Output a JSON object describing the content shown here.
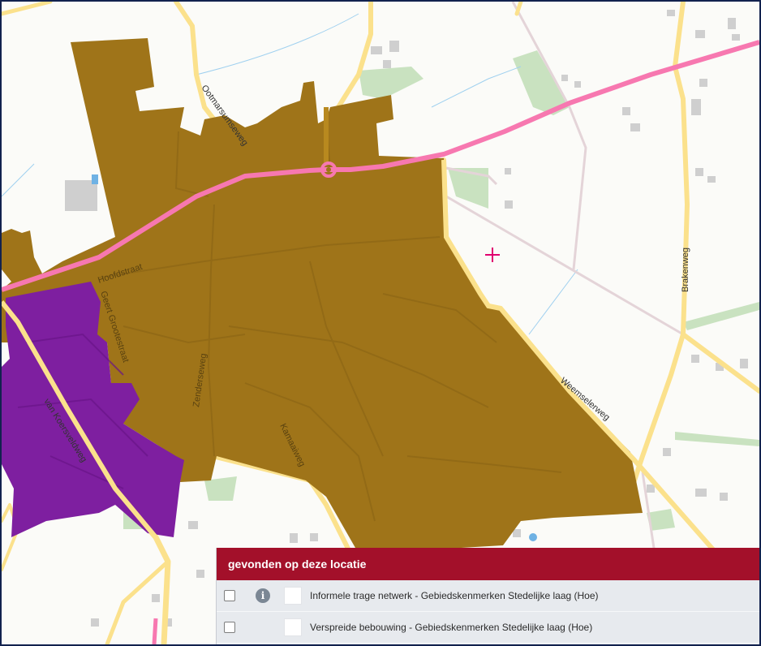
{
  "map": {
    "road_labels": {
      "ootmarsumseweg": "Ootmarsumseweg",
      "hoofdstraat": "Hoofdstraat",
      "geert_grootestraat": "Geert Grootestraat",
      "zenderseweg": "Zenderseweg",
      "kamaaiweg": "Kamaaiweg",
      "van_koersveldweg": "van Koersveldweg",
      "weemselerweg": "Weemselerweg",
      "brakenweg": "Brakenweg"
    },
    "colors": {
      "built_area": "#9f7419",
      "dispersed_area": "#7e1fa0",
      "main_road": "#f778b0",
      "road": "#fbe18c",
      "greenery": "#c9e2c0",
      "water": "#9fd0ef",
      "marker": "#e0006f"
    }
  },
  "results_panel": {
    "title": "gevonden op deze locatie",
    "items": [
      {
        "label": "Informele trage netwerk - Gebiedskenmerken Stedelijke laag (Hoe)",
        "has_info": true
      },
      {
        "label": "Verspreide bebouwing - Gebiedskenmerken Stedelijke laag (Hoe)",
        "has_info": false
      }
    ]
  }
}
